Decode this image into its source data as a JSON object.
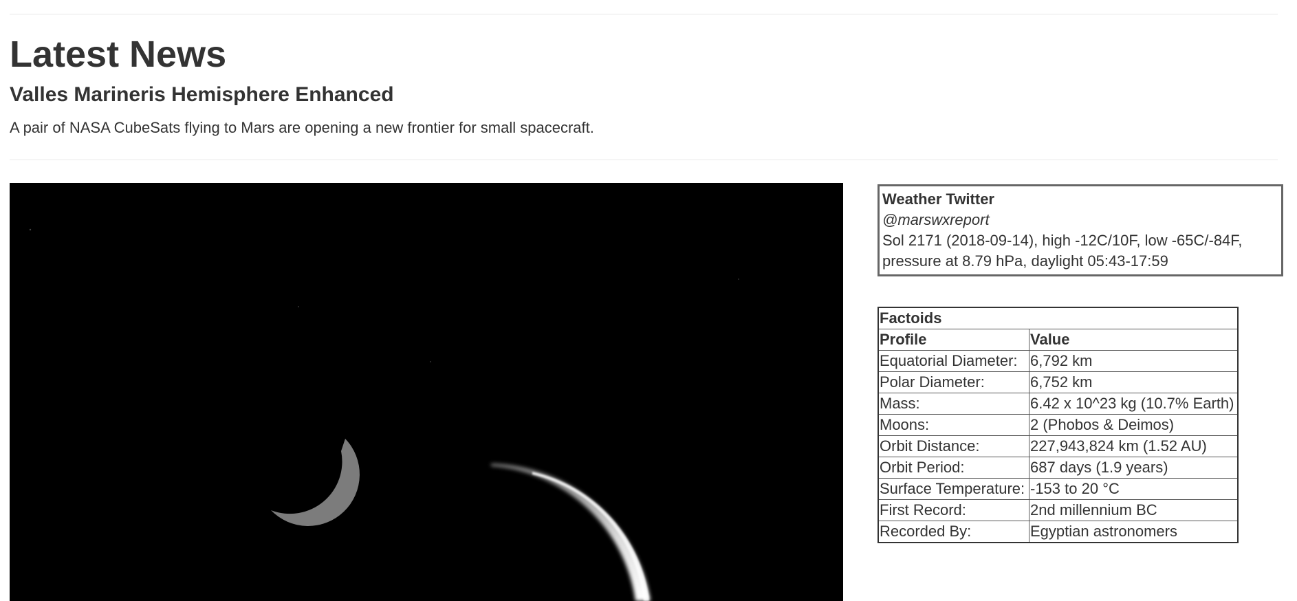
{
  "news": {
    "heading": "Latest News",
    "title": "Valles Marineris Hemisphere Enhanced",
    "teaser": "A pair of NASA CubeSats flying to Mars are opening a new frontier for small spacecraft."
  },
  "weather": {
    "title": "Weather Twitter",
    "handle": "@marswxreport",
    "report": "Sol 2171 (2018-09-14), high -12C/10F, low -65C/-84F, pressure at 8.79 hPa, daylight 05:43-17:59"
  },
  "facts": {
    "caption": "Factoids",
    "headers": [
      "Profile",
      "Value"
    ],
    "rows": [
      [
        "Equatorial Diameter:",
        "6,792 km"
      ],
      [
        "Polar Diameter:",
        "6,752 km"
      ],
      [
        "Mass:",
        "6.42 x 10^23 kg (10.7% Earth)"
      ],
      [
        "Moons:",
        "2 (Phobos & Deimos)"
      ],
      [
        "Orbit Distance:",
        "227,943,824 km (1.52 AU)"
      ],
      [
        "Orbit Period:",
        "687 days (1.9 years)"
      ],
      [
        "Surface Temperature:",
        "-153 to 20 °C"
      ],
      [
        "First Record:",
        "2nd millennium BC"
      ],
      [
        "Recorded By:",
        "Egyptian astronomers"
      ]
    ]
  },
  "colors": {
    "text": "#333333",
    "divider": "#e8e8e8",
    "image_background": "#000000"
  }
}
